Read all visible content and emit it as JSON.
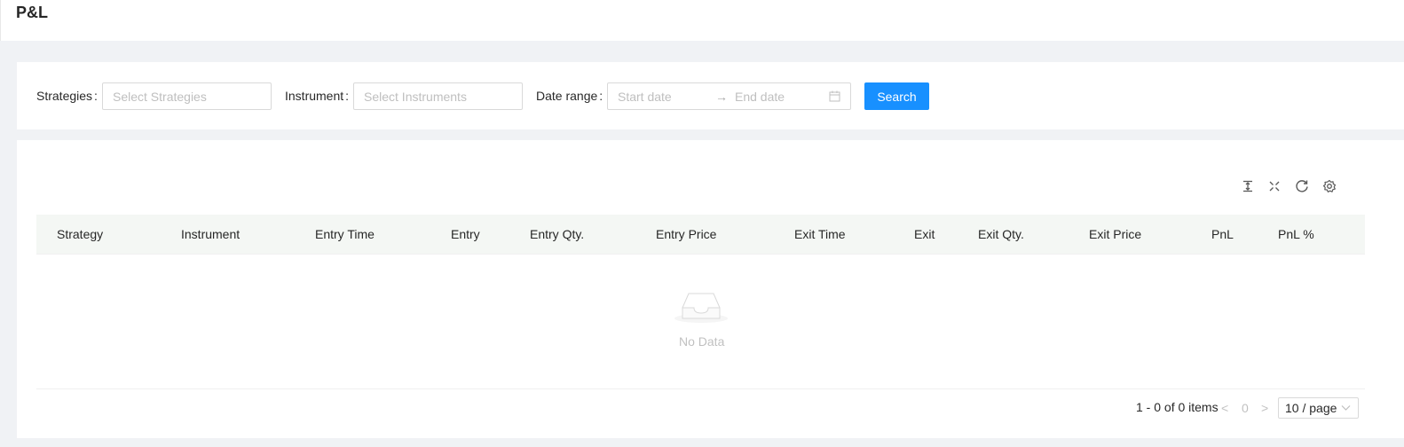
{
  "header": {
    "title": "P&L"
  },
  "filters": {
    "strategies_label": "Strategies",
    "strategies_placeholder": "Select Strategies",
    "instrument_label": "Instrument",
    "instrument_placeholder": "Select Instruments",
    "date_range_label": "Date range",
    "start_date_placeholder": "Start date",
    "end_date_placeholder": "End date",
    "separator": "→",
    "search_label": "Search"
  },
  "toolbar": {
    "icons": [
      "column-height-icon",
      "fullscreen-icon",
      "reload-icon",
      "setting-icon"
    ]
  },
  "table": {
    "columns": [
      "Strategy",
      "Instrument",
      "Entry Time",
      "Entry",
      "Entry Qty.",
      "Entry Price",
      "Exit Time",
      "Exit",
      "Exit Qty.",
      "Exit Price",
      "PnL",
      "PnL %"
    ],
    "rows": [],
    "empty_text": "No Data"
  },
  "pagination": {
    "total_text": "1 - 0 of 0 items",
    "prev": "<",
    "current_page": "0",
    "next": ">",
    "page_size": "10 / page"
  },
  "colors": {
    "primary": "#1890ff",
    "page_background": "#f0f2f5",
    "table_header_background": "#f4f7f4"
  }
}
